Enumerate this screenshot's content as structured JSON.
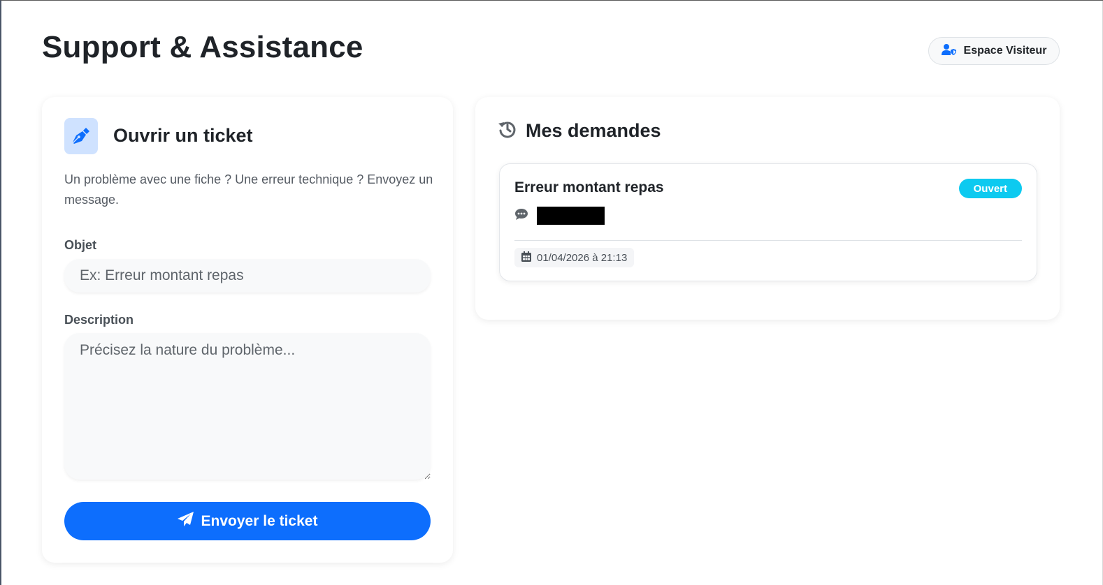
{
  "header": {
    "title": "Support & Assistance",
    "visitor_button": "Espace Visiteur"
  },
  "ticket_form": {
    "title": "Ouvrir un ticket",
    "intro": "Un problème avec une fiche ? Une erreur technique ? Envoyez un message.",
    "subject_label": "Objet",
    "subject_placeholder": "Ex: Erreur montant repas",
    "description_label": "Description",
    "description_placeholder": "Précisez la nature du problème...",
    "submit_label": "Envoyer le ticket"
  },
  "requests": {
    "title": "Mes demandes",
    "items": [
      {
        "title": "Erreur montant repas",
        "status": "Ouvert",
        "date": "01/04/2026 à 21:13"
      }
    ]
  },
  "colors": {
    "primary": "#0d6efd",
    "status_open": "#0dcaf0",
    "icon_bg": "#cfe2ff"
  },
  "icons": [
    "user-shield-icon",
    "pen-nib-icon",
    "history-icon",
    "comment-dots-icon",
    "calendar-icon",
    "paper-plane-icon"
  ]
}
